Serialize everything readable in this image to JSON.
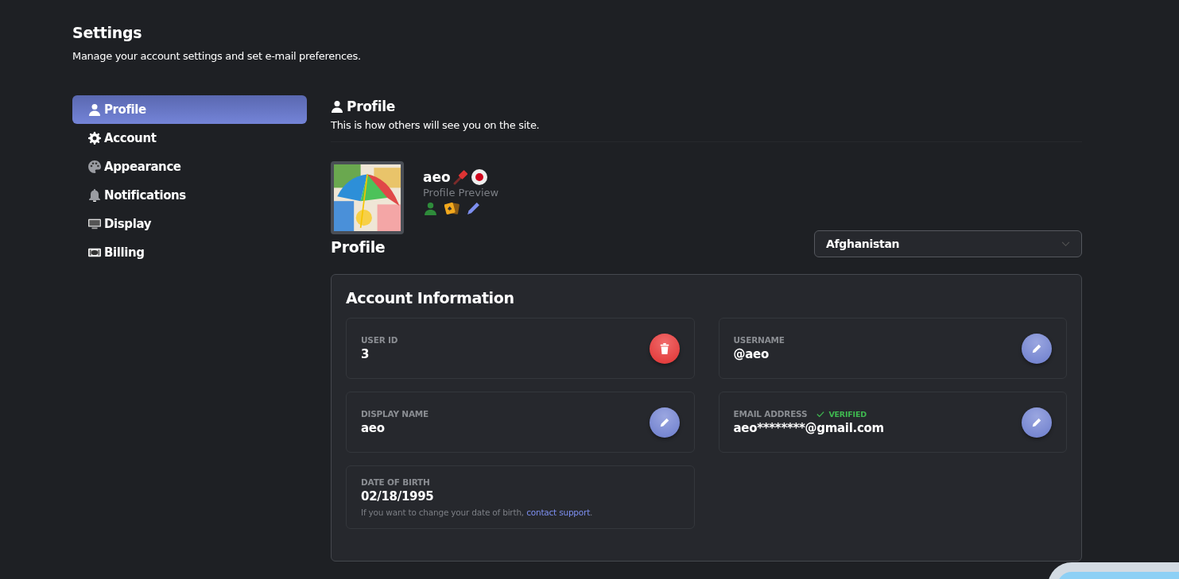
{
  "header": {
    "title": "Settings",
    "subtitle": "Manage your account settings and set e-mail preferences."
  },
  "sidebar": {
    "items": [
      {
        "label": "Profile",
        "selected": true
      },
      {
        "label": "Account",
        "selected": false
      },
      {
        "label": "Appearance",
        "selected": false
      },
      {
        "label": "Notifications",
        "selected": false
      },
      {
        "label": "Display",
        "selected": false
      },
      {
        "label": "Billing",
        "selected": false
      }
    ]
  },
  "section": {
    "title": "Profile",
    "description": "This is how others will see you on the site."
  },
  "preview": {
    "kind": "picture",
    "name": "aeo",
    "caption": "Profile Preview"
  },
  "profile_heading": "Profile",
  "country_select": {
    "value": "Afghanistan"
  },
  "account_info": {
    "title": "Account Information",
    "fields": [
      {
        "kind": "deletable",
        "label": "USER ID",
        "value": "3"
      },
      {
        "kind": "editable",
        "label": "USERNAME",
        "value": "@aeo"
      },
      {
        "kind": "editable",
        "label": "DISPLAY NAME",
        "value": "aeo"
      },
      {
        "kind": "editable",
        "label": "EMAIL ADDRESS",
        "badge": "VERIFIED",
        "value": "aeo********@gmail.com"
      },
      {
        "kind": "fixed",
        "label": "DATE OF BIRTH",
        "value": "02/18/1995",
        "note": "If you want to change your date of birth, ",
        "link": "contact support",
        "note_end": "."
      }
    ]
  }
}
